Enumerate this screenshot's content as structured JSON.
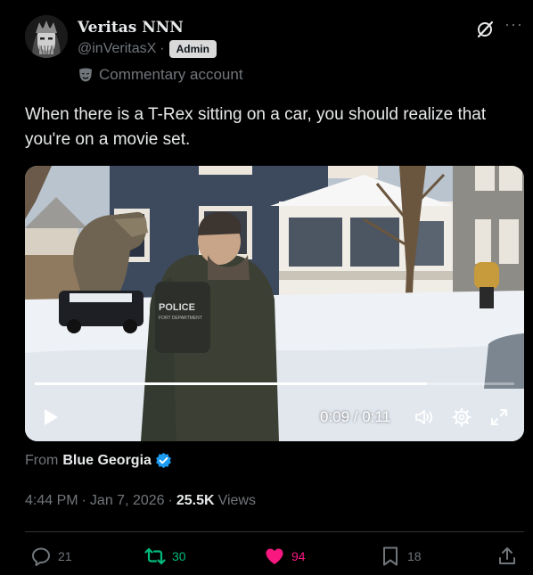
{
  "author": {
    "display_name": "Veritas NNN",
    "handle": "@inVeritasX",
    "separator": "·",
    "badge": "Admin",
    "affiliation_icon": "mask-icon",
    "affiliation": "Commentary account"
  },
  "header_icons": [
    "grok-icon",
    "more-icon"
  ],
  "more_glyph": "···",
  "tweet": {
    "text": "When there is a T-Rex sitting on a car, you should realize that you're on a movie set."
  },
  "video": {
    "time_display": "0:09 / 0:11",
    "elapsed_seconds": 9,
    "duration_seconds": 11,
    "controls": [
      "play-icon",
      "volume-icon",
      "settings-icon",
      "fullscreen-icon"
    ],
    "scene_text": {
      "vest_label": "POLICE",
      "vest_sublabel": "FORT DEPARTMENT"
    }
  },
  "source": {
    "prefix": "From",
    "name": "Blue Georgia",
    "verified": true
  },
  "meta": {
    "time": "4:44 PM",
    "dot": "·",
    "date": "Jan 7, 2026",
    "views_count": "25.5K",
    "views_label": "Views"
  },
  "actions": {
    "replies": "21",
    "reposts": "30",
    "likes": "94",
    "bookmarks": "18"
  },
  "colors": {
    "background": "#000000",
    "text_primary": "#e7e9ea",
    "text_secondary": "#71767b",
    "repost_green": "#00ba7c",
    "like_pink": "#f91880",
    "verified_blue": "#1d9bf0",
    "divider": "#2f3336"
  }
}
